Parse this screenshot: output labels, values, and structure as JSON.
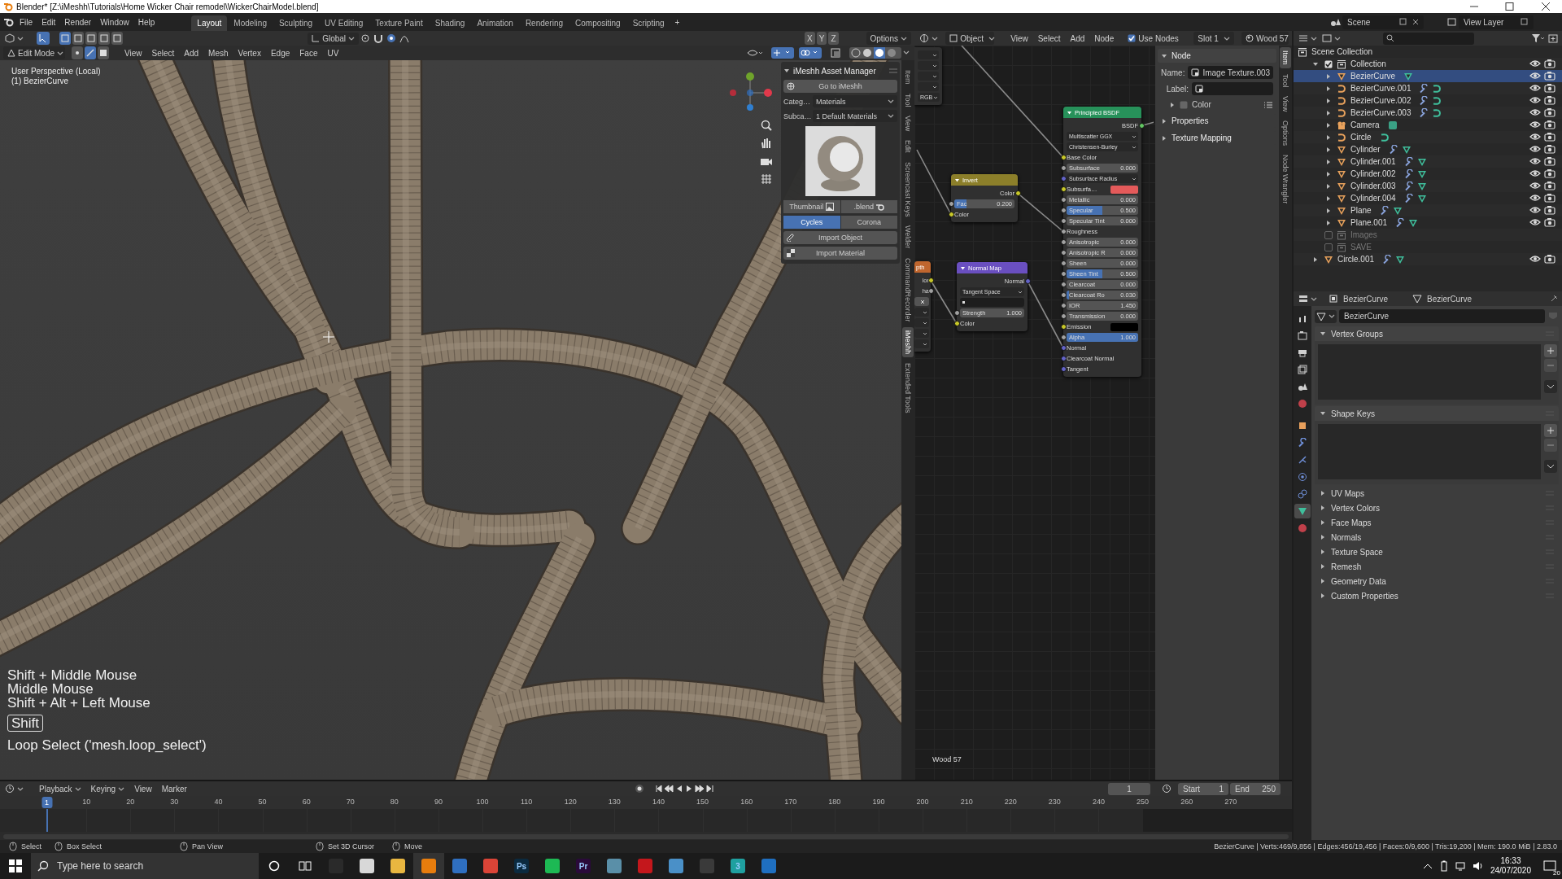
{
  "title_bar": {
    "title": "Blender* [Z:\\iMeshh\\Tutorials\\Home Wicker Chair remodel\\WickerChairModel.blend]"
  },
  "top_bar": {
    "menus": [
      "File",
      "Edit",
      "Render",
      "Window",
      "Help"
    ],
    "workspaces": [
      {
        "label": "Layout",
        "selected": true
      },
      {
        "label": "Modeling",
        "selected": false
      },
      {
        "label": "Sculpting",
        "selected": false
      },
      {
        "label": "UV Editing",
        "selected": false
      },
      {
        "label": "Texture Paint",
        "selected": false
      },
      {
        "label": "Shading",
        "selected": false
      },
      {
        "label": "Animation",
        "selected": false
      },
      {
        "label": "Rendering",
        "selected": false
      },
      {
        "label": "Compositing",
        "selected": false
      },
      {
        "label": "Scripting",
        "selected": false
      }
    ],
    "add_workspace": "+",
    "scene": "Scene",
    "view_layer": "View Layer"
  },
  "viewport": {
    "tool_header": {
      "orientation": "Global",
      "axes": [
        "X",
        "Y",
        "Z"
      ],
      "options": "Options"
    },
    "header": {
      "mode": "Edit Mode",
      "menus": [
        "View",
        "Select",
        "Add",
        "Mesh",
        "Vertex",
        "Edge",
        "Face",
        "UV"
      ]
    },
    "view_name": "User Perspective (Local)",
    "active_object": "(1) BezierCurve",
    "screencast": {
      "lines": [
        "Shift + Middle Mouse",
        "Middle Mouse",
        "Shift + Alt + Left Mouse"
      ],
      "held_key": "Shift",
      "operator": "Loop Select ('mesh.loop_select')"
    },
    "asset_manager": {
      "title": "iMeshh Asset Manager",
      "go_button": "Go to iMeshh",
      "fields": [
        {
          "label": "Categ…",
          "value": "Materials"
        },
        {
          "label": "Subca…",
          "value": "1 Default Materials"
        }
      ],
      "thumbnail_button": "Thumbnail",
      "blend_button": ".blend",
      "engines": [
        {
          "label": "Cycles",
          "selected": true
        },
        {
          "label": "Corona",
          "selected": false
        }
      ],
      "import_object": "Import Object",
      "import_material": "Import Material"
    },
    "sidebar_tabs": [
      {
        "label": "Item",
        "selected": false
      },
      {
        "label": "Tool",
        "selected": false
      },
      {
        "label": "View",
        "selected": false
      },
      {
        "label": "Edit",
        "selected": false
      },
      {
        "label": "Screencast Keys",
        "selected": false
      },
      {
        "label": "Welder",
        "selected": false
      },
      {
        "label": "CommandRecorder",
        "selected": false
      },
      {
        "label": "iMeshh",
        "selected": true
      },
      {
        "label": "Extended Tools",
        "selected": false
      }
    ]
  },
  "node_editor": {
    "header": {
      "type": "Object",
      "menus": [
        "View",
        "Select",
        "Add",
        "Node"
      ],
      "use_nodes": {
        "label": "Use Nodes",
        "checked": true
      },
      "slot": "Slot 1",
      "material": "Wood 57"
    },
    "nodes": [
      {
        "rows": [
          {
            "kind": "dropdown"
          },
          {
            "kind": "dropdown"
          },
          {
            "kind": "dropdown"
          },
          {
            "kind": "dropdown"
          },
          {
            "kind": "dropdown",
            "label": "RGB"
          }
        ]
      },
      {
        "title": "Invert",
        "color": "#8c7f2a",
        "rows": [
          {
            "kind": "output",
            "label": "Color",
            "socket": {
              "color": "#c7c729"
            }
          },
          {
            "kind": "slider",
            "label": "Fac",
            "value": "0.200",
            "level": 0.2,
            "socket": {
              "color": "#a1a1a1"
            }
          },
          {
            "kind": "input",
            "label": "Color",
            "socket": {
              "color": "#c7c729"
            }
          }
        ]
      },
      {
        "title": "Principled BSDF",
        "color": "#27915a",
        "rows": [
          {
            "kind": "output",
            "label": "BSDF",
            "socket": {
              "color": "#63c763"
            }
          },
          {
            "kind": "dropdown",
            "label": "Multiscatter GGX"
          },
          {
            "kind": "dropdown",
            "label": "Christensen-Burley"
          },
          {
            "kind": "input",
            "label": "Base Color",
            "socket": {
              "color": "#c7c729"
            }
          },
          {
            "kind": "value",
            "label": "Subsurface",
            "value": "0.000",
            "socket": {
              "color": "#a1a1a1"
            }
          },
          {
            "kind": "dropdown",
            "label": "Subsurface Radius",
            "socket": {
              "color": "#6363c7"
            }
          },
          {
            "kind": "swatch",
            "label": "Subsurfa…",
            "color": "#e45a5a",
            "socket": {
              "color": "#c7c729"
            }
          },
          {
            "kind": "value",
            "label": "Metallic",
            "value": "0.000",
            "socket": {
              "color": "#a1a1a1"
            }
          },
          {
            "kind": "slider",
            "label": "Specular",
            "value": "0.500",
            "level": 0.5,
            "socket": {
              "color": "#a1a1a1"
            }
          },
          {
            "kind": "value",
            "label": "Specular Tint",
            "value": "0.000",
            "socket": {
              "color": "#a1a1a1"
            }
          },
          {
            "kind": "input",
            "label": "Roughness",
            "socket": {
              "color": "#a1a1a1"
            }
          },
          {
            "kind": "value",
            "label": "Anisotropic",
            "value": "0.000",
            "socket": {
              "color": "#a1a1a1"
            }
          },
          {
            "kind": "value",
            "label": "Anisotropic R",
            "value": "0.000",
            "socket": {
              "color": "#a1a1a1"
            }
          },
          {
            "kind": "value",
            "label": "Sheen",
            "value": "0.000",
            "socket": {
              "color": "#a1a1a1"
            }
          },
          {
            "kind": "slider",
            "label": "Sheen Tint",
            "value": "0.500",
            "level": 0.5,
            "socket": {
              "color": "#a1a1a1"
            }
          },
          {
            "kind": "value",
            "label": "Clearcoat",
            "value": "0.000",
            "socket": {
              "color": "#a1a1a1"
            }
          },
          {
            "kind": "slider",
            "label": "Clearcoat Ro",
            "value": "0.030",
            "level": 0.03,
            "socket": {
              "color": "#a1a1a1"
            }
          },
          {
            "kind": "value",
            "label": "IOR",
            "value": "1.450",
            "socket": {
              "color": "#a1a1a1"
            }
          },
          {
            "kind": "value",
            "label": "Transmission",
            "value": "0.000",
            "socket": {
              "color": "#a1a1a1"
            }
          },
          {
            "kind": "swatch",
            "label": "Emission",
            "color": "#000000",
            "socket": {
              "color": "#c7c729"
            }
          },
          {
            "kind": "slider",
            "label": "Alpha",
            "value": "1.000",
            "level": 1,
            "socket": {
              "color": "#a1a1a1"
            }
          },
          {
            "kind": "input",
            "label": "Normal",
            "socket": {
              "color": "#6363c7"
            }
          },
          {
            "kind": "input",
            "label": "Clearcoat Normal",
            "socket": {
              "color": "#6363c7"
            }
          },
          {
            "kind": "input",
            "label": "Tangent",
            "socket": {
              "color": "#6363c7"
            }
          }
        ]
      },
      {
        "title": "pth",
        "color": "#c0662e",
        "rows": [
          {
            "kind": "output",
            "label": "lor",
            "socket": {
              "color": "#c7c729"
            }
          },
          {
            "kind": "output",
            "label": "ha",
            "socket": {
              "color": "#a1a1a1"
            }
          },
          {
            "kind": "close"
          },
          {
            "kind": "dropdown"
          },
          {
            "kind": "dropdown"
          },
          {
            "kind": "dropdown"
          },
          {
            "kind": "dropdown"
          }
        ]
      },
      {
        "title": "Normal Map",
        "color": "#6a4fc0",
        "rows": [
          {
            "kind": "output",
            "label": "Normal",
            "socket": {
              "color": "#6363c7"
            }
          },
          {
            "kind": "dropdown",
            "label": "Tangent Space"
          },
          {
            "kind": "field"
          },
          {
            "kind": "value",
            "label": "Strength",
            "value": "1.000",
            "socket": {
              "color": "#a1a1a1"
            }
          },
          {
            "kind": "input",
            "label": "Color",
            "socket": {
              "color": "#c7c729"
            }
          }
        ]
      }
    ],
    "tree_name": "Wood 57",
    "sidebar": {
      "tabs": [
        {
          "label": "Item",
          "selected": true
        },
        {
          "label": "Tool",
          "selected": false
        },
        {
          "label": "View",
          "selected": false
        },
        {
          "label": "Options",
          "selected": false
        },
        {
          "label": "Node Wrangler",
          "selected": false
        }
      ],
      "panel": {
        "title": "Node",
        "expanded": true,
        "name_label": "Name:",
        "name_value": "Image Texture.003",
        "label_label": "Label:",
        "color": {
          "title": "Color",
          "expanded": false,
          "checked": false
        }
      },
      "panels": [
        {
          "title": "Properties",
          "expanded": false
        },
        {
          "title": "Texture Mapping",
          "expanded": false
        }
      ]
    }
  },
  "outliner": {
    "tree": [
      {
        "name": "Scene Collection",
        "kind": "scene_collection",
        "children": [
          {
            "name": "Collection",
            "kind": "collection",
            "included": true,
            "expanded": true,
            "children": [
              {
                "name": "BezierCurve",
                "kind": "mesh",
                "selected": true,
                "expanded": false,
                "modifier": false
              },
              {
                "name": "BezierCurve.001",
                "kind": "curve",
                "selected": false,
                "expanded": false,
                "modifier": true
              },
              {
                "name": "BezierCurve.002",
                "kind": "curve",
                "selected": false,
                "expanded": false,
                "modifier": true
              },
              {
                "name": "BezierCurve.003",
                "kind": "curve",
                "selected": false,
                "expanded": false,
                "modifier": true
              },
              {
                "name": "Camera",
                "kind": "camera",
                "selected": false,
                "expanded": false,
                "modifier": false
              },
              {
                "name": "Circle",
                "kind": "curve",
                "selected": false,
                "expanded": false,
                "modifier": false
              },
              {
                "name": "Cylinder",
                "kind": "mesh",
                "selected": false,
                "expanded": false,
                "modifier": true
              },
              {
                "name": "Cylinder.001",
                "kind": "mesh",
                "selected": false,
                "expanded": false,
                "modifier": true
              },
              {
                "name": "Cylinder.002",
                "kind": "mesh",
                "selected": false,
                "expanded": false,
                "modifier": true
              },
              {
                "name": "Cylinder.003",
                "kind": "mesh",
                "selected": false,
                "expanded": false,
                "modifier": true
              },
              {
                "name": "Cylinder.004",
                "kind": "mesh",
                "selected": false,
                "expanded": false,
                "modifier": true
              },
              {
                "name": "Plane",
                "kind": "mesh",
                "selected": false,
                "expanded": false,
                "modifier": true
              },
              {
                "name": "Plane.001",
                "kind": "mesh",
                "selected": false,
                "expanded": false,
                "modifier": true
              }
            ]
          },
          {
            "name": "Images",
            "kind": "collection",
            "included": false
          },
          {
            "name": "SAVE",
            "kind": "collection",
            "included": false
          },
          {
            "name": "Circle.001",
            "kind": "mesh",
            "selected": false,
            "expanded": false,
            "modifier": true
          }
        ]
      }
    ]
  },
  "properties": {
    "object": "BezierCurve",
    "data": "BezierCurve",
    "data_name": "BezierCurve",
    "tabs": [
      {
        "kind": "tool",
        "selected": false
      },
      {
        "kind": "render",
        "selected": false
      },
      {
        "kind": "output",
        "selected": false
      },
      {
        "kind": "view_layer",
        "selected": false
      },
      {
        "kind": "scene",
        "selected": false
      },
      {
        "kind": "world",
        "selected": false
      },
      {
        "kind": "object",
        "selected": false
      },
      {
        "kind": "modifiers",
        "selected": false
      },
      {
        "kind": "particles",
        "selected": false
      },
      {
        "kind": "physics",
        "selected": false
      },
      {
        "kind": "constraints",
        "selected": false
      },
      {
        "kind": "data",
        "selected": true
      },
      {
        "kind": "material",
        "selected": false
      }
    ],
    "panels": [
      {
        "title": "Vertex Groups",
        "expanded": true
      },
      {
        "title": "Shape Keys",
        "expanded": true
      },
      {
        "title": "UV Maps",
        "expanded": false
      },
      {
        "title": "Vertex Colors",
        "expanded": false
      },
      {
        "title": "Face Maps",
        "expanded": false
      },
      {
        "title": "Normals",
        "expanded": false
      },
      {
        "title": "Texture Space",
        "expanded": false
      },
      {
        "title": "Remesh",
        "expanded": false
      },
      {
        "title": "Geometry Data",
        "expanded": false
      },
      {
        "title": "Custom Properties",
        "expanded": false
      }
    ]
  },
  "timeline": {
    "menus": [
      "Playback",
      "Keying",
      "View",
      "Marker"
    ],
    "current_frame": "1",
    "start_label": "Start",
    "start": "1",
    "end_label": "End",
    "end": "250",
    "playhead": "1",
    "ticks": [
      "10",
      "20",
      "30",
      "40",
      "50",
      "60",
      "70",
      "80",
      "90",
      "100",
      "110",
      "120",
      "130",
      "140",
      "150",
      "160",
      "170",
      "180",
      "190",
      "200",
      "210",
      "220",
      "230",
      "240",
      "250",
      "260",
      "270"
    ]
  },
  "status_bar": {
    "hints": [
      "Select",
      "Box Select",
      "Pan View",
      "Set 3D Cursor",
      "Move"
    ],
    "stats": "BezierCurve | Verts:469/9,856 | Edges:456/19,456 | Faces:0/9,600 | Tris:19,200 | Mem: 190.0 MiB | 2.83.0"
  },
  "taskbar": {
    "placeholder": "Type here to search",
    "apps": [
      {
        "color": "#2a2a2a",
        "selected": false
      },
      {
        "color": "#d8d8d8",
        "selected": false
      },
      {
        "color": "#e8b640",
        "selected": false
      },
      {
        "color": "#e87d0d",
        "selected": true
      },
      {
        "color": "#2f6fc0",
        "selected": false
      },
      {
        "color": "#db4437",
        "selected": false
      },
      {
        "color": "#0b2a3f",
        "label": "Ps",
        "selected": false
      },
      {
        "color": "#1db954",
        "selected": false
      },
      {
        "color": "#2a0a3a",
        "label": "Pr",
        "selected": false
      },
      {
        "color": "#5a8fa8",
        "selected": false
      },
      {
        "color": "#c4171c",
        "selected": false
      },
      {
        "color": "#4a90c8",
        "selected": false
      },
      {
        "color": "#3a3a3a",
        "selected": false
      },
      {
        "color": "#1fa0a0",
        "label": "3",
        "selected": false
      },
      {
        "color": "#1f6fc0",
        "selected": false
      }
    ],
    "time": "16:33",
    "date": "24/07/2020",
    "notifications": "20"
  }
}
